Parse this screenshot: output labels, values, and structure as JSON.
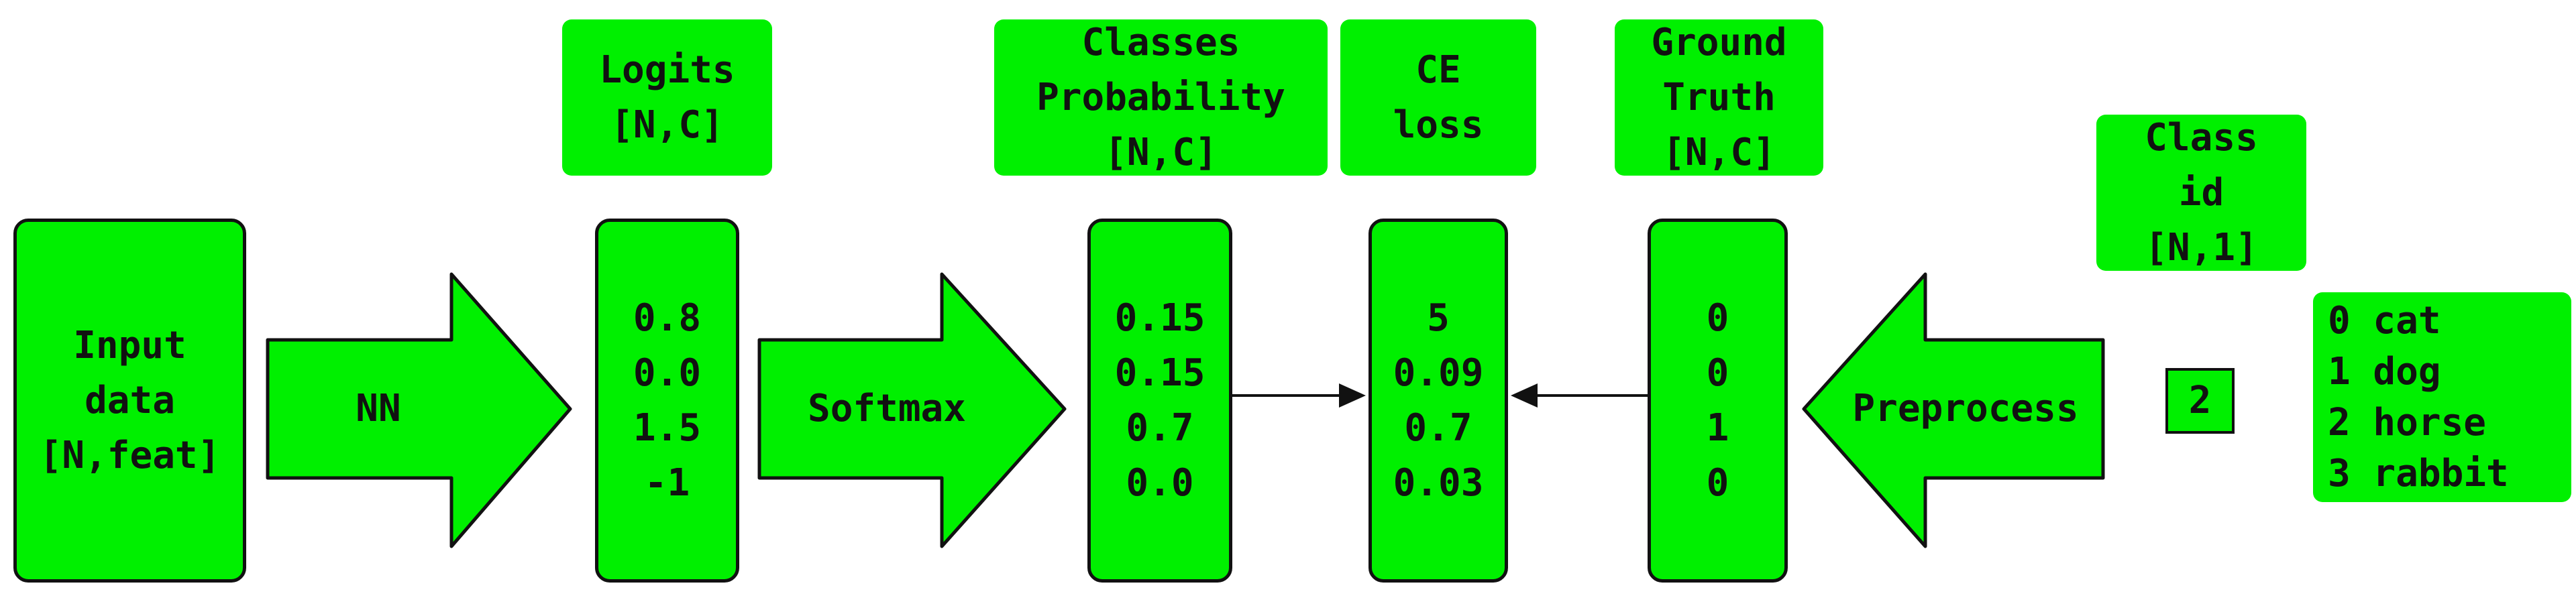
{
  "colors": {
    "fill": "#00f000",
    "stroke": "#111111"
  },
  "input_box": {
    "lines": [
      "Input",
      "data",
      "[N,feat]"
    ]
  },
  "arrows": {
    "nn": "NN",
    "softmax": "Softmax",
    "preprocess": "Preprocess"
  },
  "labels": {
    "logits": [
      "Logits",
      "[N,C]"
    ],
    "probability": [
      "Classes",
      "Probability",
      "[N,C]"
    ],
    "ce_loss": [
      "CE",
      "loss"
    ],
    "ground_truth": [
      "Ground",
      "Truth",
      "[N,C]"
    ],
    "class_id": [
      "Class",
      "id",
      "[N,1]"
    ]
  },
  "columns": {
    "logits": [
      "0.8",
      "0.0",
      "1.5",
      "-1"
    ],
    "probability": [
      "0.15",
      "0.15",
      "0.7",
      "0.0"
    ],
    "ce_loss": [
      "5",
      "0.09",
      "0.7",
      "0.03"
    ],
    "ground_truth": [
      "0",
      "0",
      "1",
      "0"
    ]
  },
  "class_id_value": "2",
  "class_legend": [
    "0 cat",
    "1 dog",
    "2 horse",
    "3 rabbit"
  ]
}
